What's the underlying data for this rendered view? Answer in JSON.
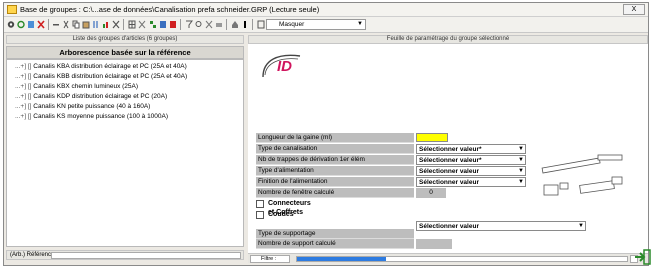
{
  "window": {
    "title": "Base de groupes : C:\\...ase de données\\Canalisation prefa schneider.GRP (Lecture seule)",
    "close_label": "X"
  },
  "toolbar": {
    "combo_value": "Masquer"
  },
  "left": {
    "header": "Liste des groupes d'articles (6 groupes)",
    "tree_title": "Arborescence basée sur la référence",
    "items": [
      {
        "prefix": "...+] []",
        "label": "Canalis KBA distribution éclairage et PC (25A et 40A)"
      },
      {
        "prefix": "...+] []",
        "label": "Canalis KBB distribution éclairage et PC (25A et 40A)"
      },
      {
        "prefix": "...+] []",
        "label": "Canalis KBX chemin lumineux (25A)"
      },
      {
        "prefix": "...+] []",
        "label": "Canalis KDP distribution éclairage et PC (20A)"
      },
      {
        "prefix": "...+] []",
        "label": "Canalis KN petite puissance (40 à 160A)"
      },
      {
        "prefix": "...+] []",
        "label": "Canalis KS moyenne puissance (100 à 1000A)"
      }
    ],
    "footer_label": "(Arb.) Référence :"
  },
  "right": {
    "header": "Feuille de paramétrage du groupe sélectionné",
    "logo_text": "ID",
    "rows": {
      "longueur": "Longueur de la gaine (ml)",
      "type_canalisation": "Type de canalisation",
      "trappes": "Nb de trappes de dérivation 1er élém",
      "alimentation": "Type d'alimentation",
      "finition": "Finition de l'alimentation",
      "fenetres": "Nombre de fenêtre calculé",
      "fenetres_value": "0",
      "connecteurs": "Connecteurs et Coffrets",
      "coudes": "Coudes",
      "supportage": "Type de supportage",
      "support_calc": "Nombre de support calculé"
    },
    "selects": {
      "type_canalisation": "Sélectionner valeur*",
      "trappes": "Sélectionner valeur*",
      "alimentation": "Sélectionner valeur",
      "finition": "Sélectionner valeur",
      "supportage": "Sélectionner valeur"
    },
    "footer_label": "Filtre :",
    "progress": 0.27
  },
  "colors": {
    "highlight": "#ffff00",
    "label_bg": "#bdbdbd",
    "progress": "#2d7be0",
    "logo": "#d0155e"
  }
}
